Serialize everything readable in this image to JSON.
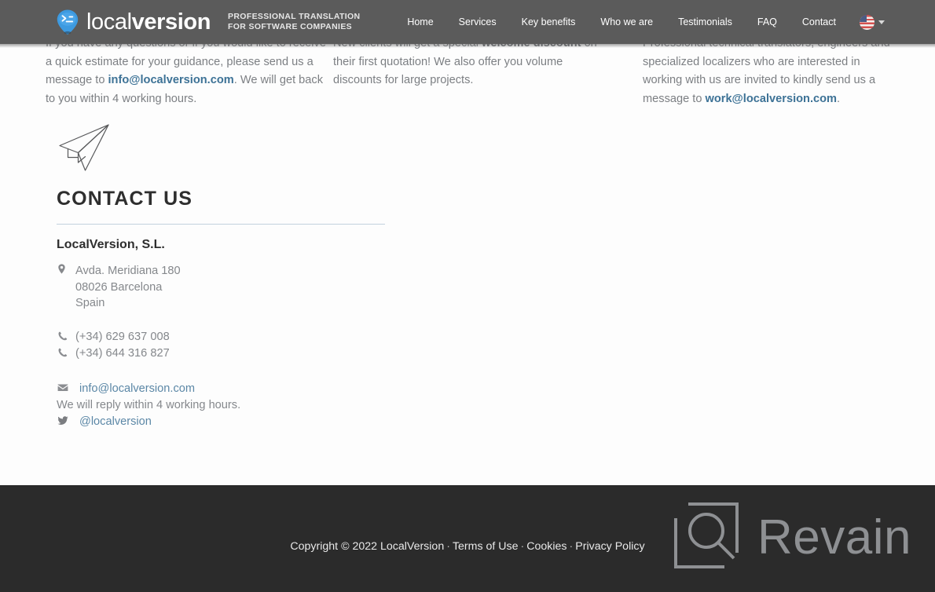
{
  "header": {
    "brand": {
      "word_light": "local",
      "word_bold": "version",
      "logo_icon": "terminal-pin-icon",
      "tagline_line1": "PROFESSIONAL TRANSLATION",
      "tagline_line2": "FOR SOFTWARE COMPANIES"
    },
    "nav": [
      {
        "label": "Home"
      },
      {
        "label": "Services"
      },
      {
        "label": "Key benefits"
      },
      {
        "label": "Who we are"
      },
      {
        "label": "Testimonials"
      },
      {
        "label": "FAQ"
      },
      {
        "label": "Contact"
      }
    ],
    "language": {
      "flag": "us-flag-icon",
      "chevron": "chevron-down-icon"
    },
    "background_color": "#5b5b5b"
  },
  "intro": {
    "col1": {
      "part1": "If you have any questions or if you would like to receive a quick estimate for your guidance, please send us a message to ",
      "link": "info@localversion.com",
      "part2": ". We will get back to you within 4 working hours."
    },
    "col2": {
      "part1": "New clients will get a special ",
      "bold": "welcome discount",
      "part2": " on their first quotation! We also offer you volume discounts for large projects."
    },
    "col3": {
      "part1": "Professional technical translators, engineers and specialized localizers who are interested in working with us are invited to kindly send us a message to ",
      "link": "work@localversion.com",
      "part2": "."
    }
  },
  "contact": {
    "plane_icon": "paper-plane-icon",
    "title": "CONTACT US",
    "company": "LocalVersion, S.L.",
    "address": {
      "icon": "map-pin-icon",
      "line1": "Avda. Meridiana 180",
      "line2": "08026 Barcelona",
      "line3": "Spain"
    },
    "phones": [
      {
        "icon": "phone-icon",
        "number": "(+34) 629 637 008"
      },
      {
        "icon": "phone-icon",
        "number": "(+34) 644 316 827"
      }
    ],
    "email": {
      "icon": "envelope-icon",
      "address": "info@localversion.com"
    },
    "reply_note": "We will reply within 4 working hours.",
    "twitter": {
      "icon": "twitter-icon",
      "handle": "@localversion"
    },
    "rule_color": "#c2d2de"
  },
  "footer": {
    "copyright": "Copyright © 2022 LocalVersion",
    "separator": "·",
    "links": [
      {
        "label": "Terms of Use"
      },
      {
        "label": "Cookies"
      },
      {
        "label": "Privacy Policy"
      }
    ],
    "watermark": {
      "icon": "revain-logo-icon",
      "text": "Revain"
    },
    "background_color": "#2b2b2b"
  }
}
